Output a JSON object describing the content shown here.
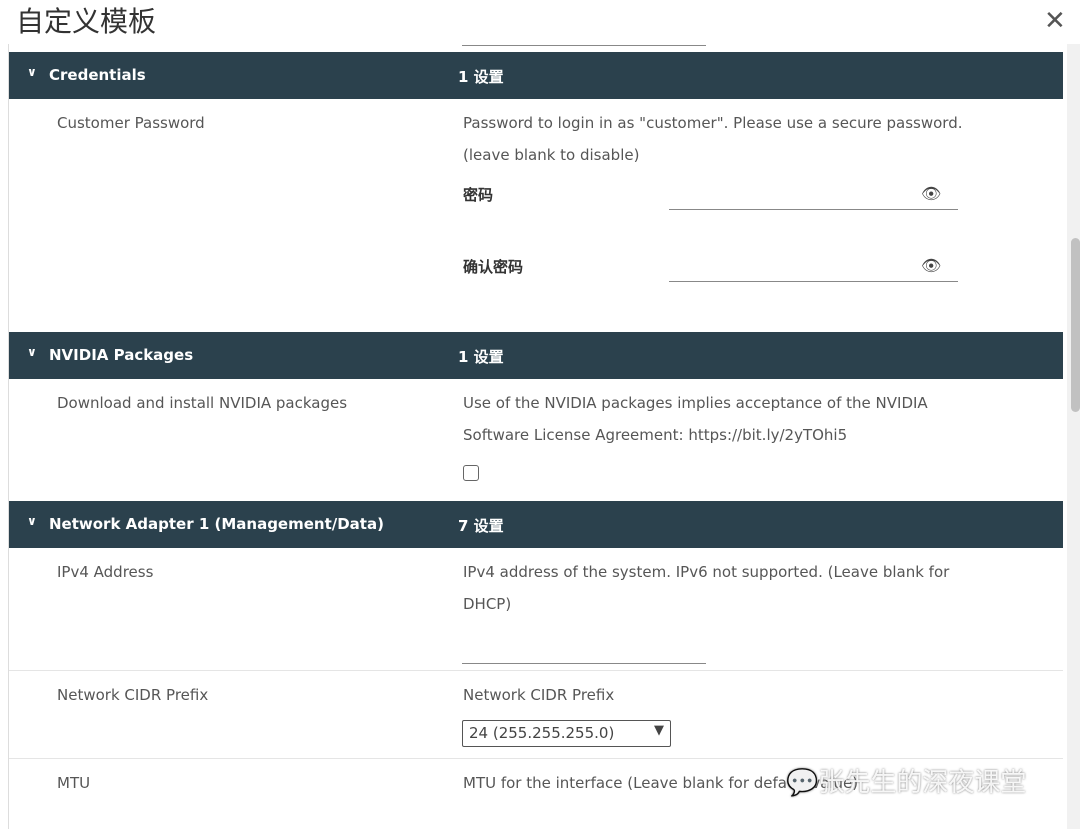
{
  "dialog": {
    "title": "自定义模板",
    "close_icon": "close-icon"
  },
  "sections": [
    {
      "name": "Credentials",
      "count": "1 设置",
      "fields": [
        {
          "label": "Customer Password",
          "description": [
            "Password to login in as \"customer\". Please use a secure password.",
            "(leave blank to disable)"
          ],
          "password_label": "密码",
          "confirm_label": "确认密码"
        }
      ]
    },
    {
      "name": "NVIDIA Packages",
      "count": "1 设置",
      "fields": [
        {
          "label": "Download and install NVIDIA packages",
          "description": [
            "Use of the NVIDIA packages implies acceptance of the NVIDIA",
            "Software License Agreement: https://bit.ly/2yTOhi5"
          ],
          "checked": false
        }
      ]
    },
    {
      "name": "Network Adapter 1 (Management/Data)",
      "count": "7 设置",
      "fields": [
        {
          "label": "IPv4 Address",
          "description": [
            "IPv4 address of the system. IPv6 not supported. (Leave blank for",
            "DHCP)"
          ],
          "value": ""
        },
        {
          "label": "Network CIDR Prefix",
          "description": [
            "Network CIDR Prefix"
          ],
          "selected": "24 (255.255.255.0)"
        },
        {
          "label": "MTU",
          "description": [
            "MTU for the interface (Leave blank for default value)"
          ]
        }
      ]
    }
  ],
  "watermark": "张先生的深夜课堂"
}
